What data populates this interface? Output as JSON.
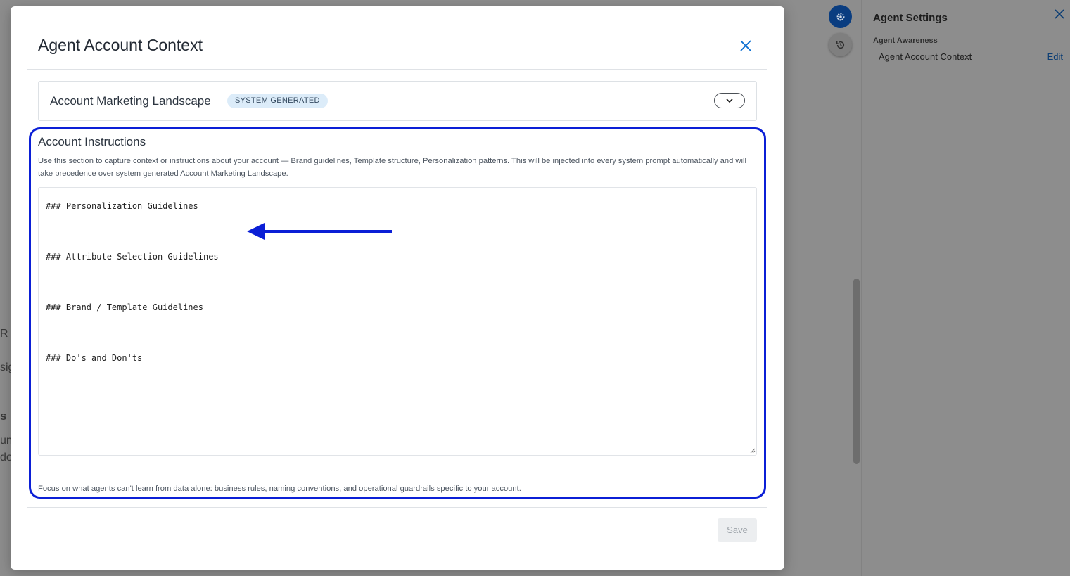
{
  "modal": {
    "title": "Agent Account Context",
    "landscape": {
      "title": "Account Marketing Landscape",
      "badge": "SYSTEM GENERATED"
    },
    "instructions": {
      "title": "Account Instructions",
      "description": "Use this section to capture context or instructions about your account — Brand guidelines, Template structure, Personalization patterns. This will be injected into every system prompt automatically and will take precedence over system generated Account Marketing Landscape.",
      "textarea_value": "### Personalization Guidelines\n\n### Attribute Selection Guidelines\n\n### Brand / Template Guidelines\n\n### Do's and Don'ts",
      "hint": "Focus on what agents can't learn from data alone: business rules, naming conventions, and operational guardrails specific to your account."
    },
    "save_label": "Save",
    "close_icon": "close-icon",
    "expand_icon": "chevron-down-icon"
  },
  "settings_panel": {
    "title": "Agent Settings",
    "section_label": "Agent Awareness",
    "row_label": "Agent Account Context",
    "row_action": "Edit"
  },
  "background": {
    "fragments": [
      "R",
      "sig",
      "s",
      "um",
      "do"
    ]
  },
  "colors": {
    "highlight": "#0b1fd6",
    "arrow": "#0b1fd6",
    "primary_blue": "#0a6ed1",
    "badge_bg": "#dcecf9"
  }
}
